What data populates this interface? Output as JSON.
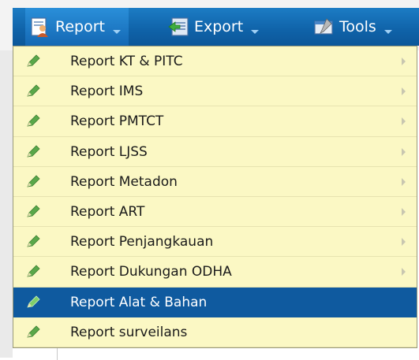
{
  "menubar": {
    "report": {
      "label": "Report",
      "icon": "report-user-icon"
    },
    "export": {
      "label": "Export",
      "icon": "export-icon"
    },
    "tools": {
      "label": "Tools",
      "icon": "tools-icon"
    }
  },
  "dropdown": {
    "items": [
      {
        "label": "Report KT & PITC",
        "has_submenu": true,
        "selected": false
      },
      {
        "label": "Report IMS",
        "has_submenu": true,
        "selected": false
      },
      {
        "label": "Report PMTCT",
        "has_submenu": true,
        "selected": false
      },
      {
        "label": "Report LJSS",
        "has_submenu": true,
        "selected": false
      },
      {
        "label": "Report Metadon",
        "has_submenu": true,
        "selected": false
      },
      {
        "label": "Report ART",
        "has_submenu": true,
        "selected": false
      },
      {
        "label": "Report Penjangkauan",
        "has_submenu": true,
        "selected": false
      },
      {
        "label": "Report Dukungan ODHA",
        "has_submenu": true,
        "selected": false
      },
      {
        "label": "Report Alat & Bahan",
        "has_submenu": false,
        "selected": true
      },
      {
        "label": "Report surveilans",
        "has_submenu": false,
        "selected": false
      }
    ],
    "colors": {
      "background": "#fbf8c4",
      "selected_background": "#0f5a9f",
      "menubar": "#0f62a8",
      "pencil": "#5aa84a"
    }
  }
}
